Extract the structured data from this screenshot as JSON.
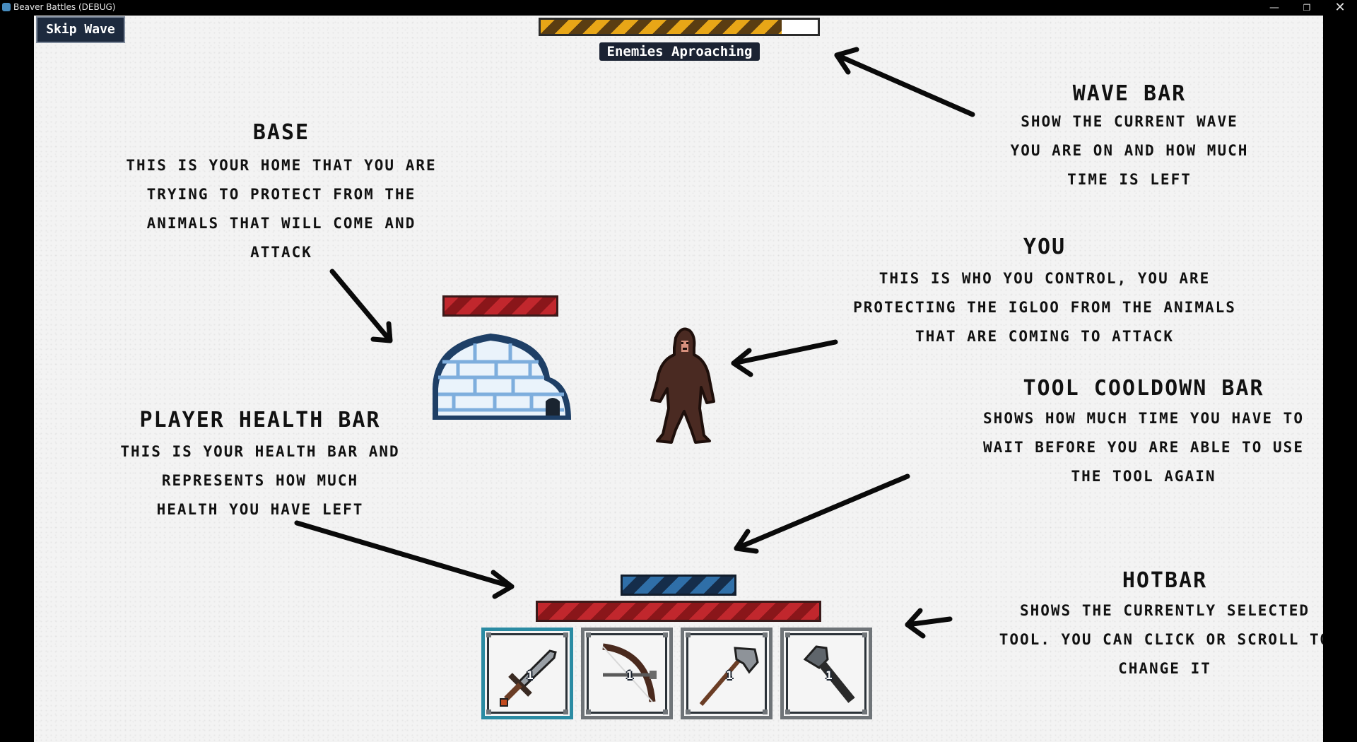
{
  "window": {
    "title": "Beaver Battles (DEBUG)",
    "controls": {
      "minimize": "—",
      "maximize": "❐",
      "close": "✕"
    }
  },
  "hud": {
    "skip_wave_label": "Skip Wave",
    "wave_status": "Enemies Aproaching",
    "wave_progress": 0.87,
    "base_health": 1.0,
    "player_health": 1.0,
    "tool_cooldown": 1.0
  },
  "annotations": {
    "base": {
      "heading": "BASE",
      "lines": [
        "THIS IS YOUR HOME THAT YOU ARE",
        "TRYING TO PROTECT FROM THE",
        "ANIMALS THAT WILL COME AND",
        "ATTACK"
      ]
    },
    "wave_bar": {
      "heading": "WAVE BAR",
      "lines": [
        "SHOW THE CURRENT WAVE",
        "YOU ARE ON AND HOW MUCH",
        "TIME IS LEFT"
      ]
    },
    "you": {
      "heading": "YOU",
      "lines": [
        "THIS IS WHO YOU CONTROL, YOU ARE",
        "PROTECTING THE IGLOO FROM THE ANIMALS",
        "THAT ARE COMING TO ATTACK"
      ]
    },
    "tool_cooldown": {
      "heading": "TOOL COOLDOWN BAR",
      "lines": [
        "SHOWS HOW MUCH TIME YOU HAVE TO",
        "WAIT BEFORE YOU ARE ABLE TO USE",
        "THE TOOL AGAIN"
      ]
    },
    "player_health": {
      "heading": "PLAYER HEALTH BAR",
      "lines": [
        "THIS IS YOUR HEALTH BAR AND",
        "REPRESENTS HOW MUCH",
        "HEALTH YOU HAVE LEFT"
      ]
    },
    "hotbar": {
      "heading": "HOTBAR",
      "lines": [
        "SHOWS THE CURRENTLY SELECTED",
        "TOOL. YOU CAN CLICK OR SCROLL TO",
        "CHANGE IT"
      ]
    }
  },
  "hotbar": {
    "slots": [
      {
        "icon": "sword-icon",
        "count": "1",
        "selected": true
      },
      {
        "icon": "bow-icon",
        "count": "1",
        "selected": false
      },
      {
        "icon": "axe-icon",
        "count": "1",
        "selected": false
      },
      {
        "icon": "hammer-icon",
        "count": "1",
        "selected": false
      }
    ]
  },
  "colors": {
    "wave_bar": "#e8a617",
    "health_bar": "#c1272d",
    "cooldown_bar": "#2f6fa8",
    "selected_slot": "#2b8ba3",
    "button_bg": "#1d2a3e"
  }
}
